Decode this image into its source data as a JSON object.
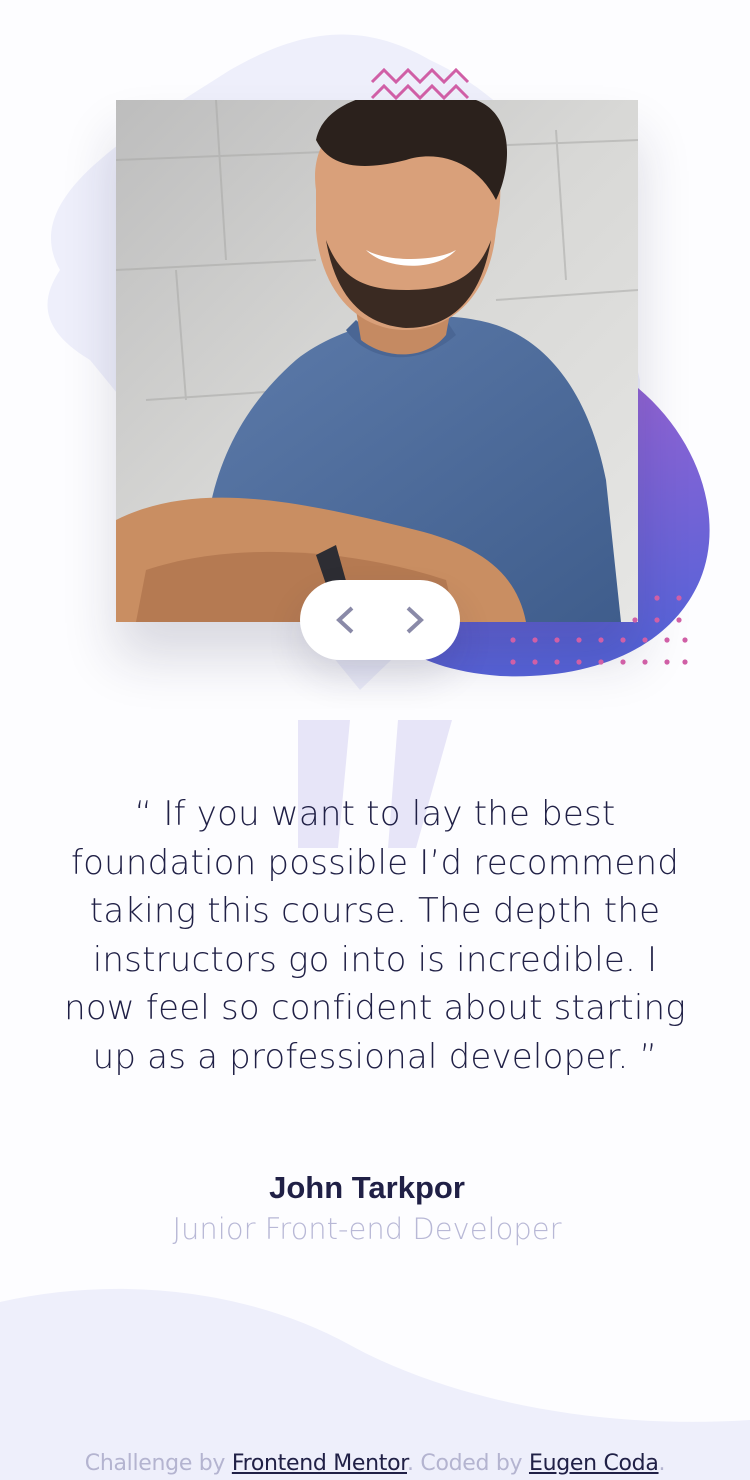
{
  "testimonial": {
    "quote": "“ If you want to lay the best foundation possible I’d recommend taking this course. The depth the instructors go into is incredible. I now feel so confident about starting up as a professional developer. ”",
    "author_name": "John Tarkpor",
    "author_role": "Junior Front-end Developer"
  },
  "navigation": {
    "prev_icon": "chevron-left-icon",
    "next_icon": "chevron-right-icon"
  },
  "footer": {
    "challenge_prefix": "Challenge by",
    "challenge_link": "Frontend Mentor",
    "coded_prefix": ". Coded by",
    "coded_link": "Eugen Coda",
    "suffix": "."
  },
  "colors": {
    "background": "#fdfdff",
    "text_dark": "#202046",
    "text_muted": "#b8b8d6",
    "accent_purple": "#8a5fd6",
    "accent_blue": "#5b5fd8",
    "accent_pink": "#d05fa6",
    "blob_light": "#eeeffb",
    "quote_mark": "#e7e5f8"
  }
}
